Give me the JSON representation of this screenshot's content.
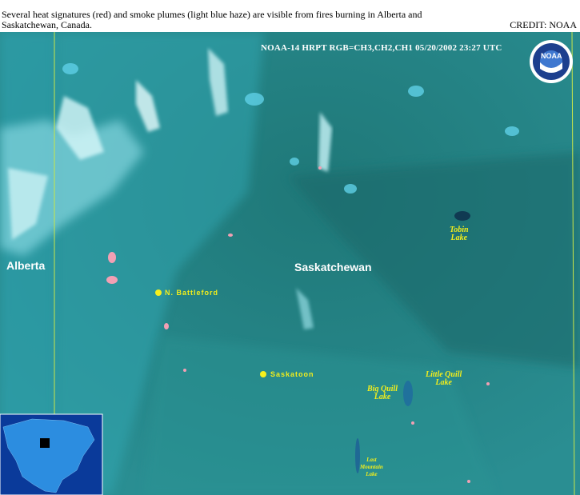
{
  "caption": "Several heat signatures (red) and smoke plumes (light blue haze) are visible from fires burning in Alberta and Saskatchewan, Canada.",
  "credit": "CREDIT: NOAA",
  "header": "NOAA-14  HRPT  RGB=CH3,CH2,CH1  05/20/2002  23:27 UTC",
  "logo": {
    "text": "NOAA"
  },
  "provinces": {
    "alberta": "Alberta",
    "saskatchewan": "Saskatchewan"
  },
  "cities": {
    "north_battleford": "N. Battleford",
    "saskatoon": "Saskatoon"
  },
  "lakes": {
    "tobin": [
      "Tobin",
      "Lake"
    ],
    "big_quill": [
      "Big Quill",
      "Lake"
    ],
    "little_quill": [
      "Little Quill",
      "Lake"
    ],
    "last_mountain": [
      "Last",
      "Mountain",
      "Lake"
    ]
  },
  "colors": {
    "land": "#2a8a8a",
    "heat": "#f2a0b4",
    "smoke": "#a8f0f8",
    "labels": "#f2ee1c"
  }
}
